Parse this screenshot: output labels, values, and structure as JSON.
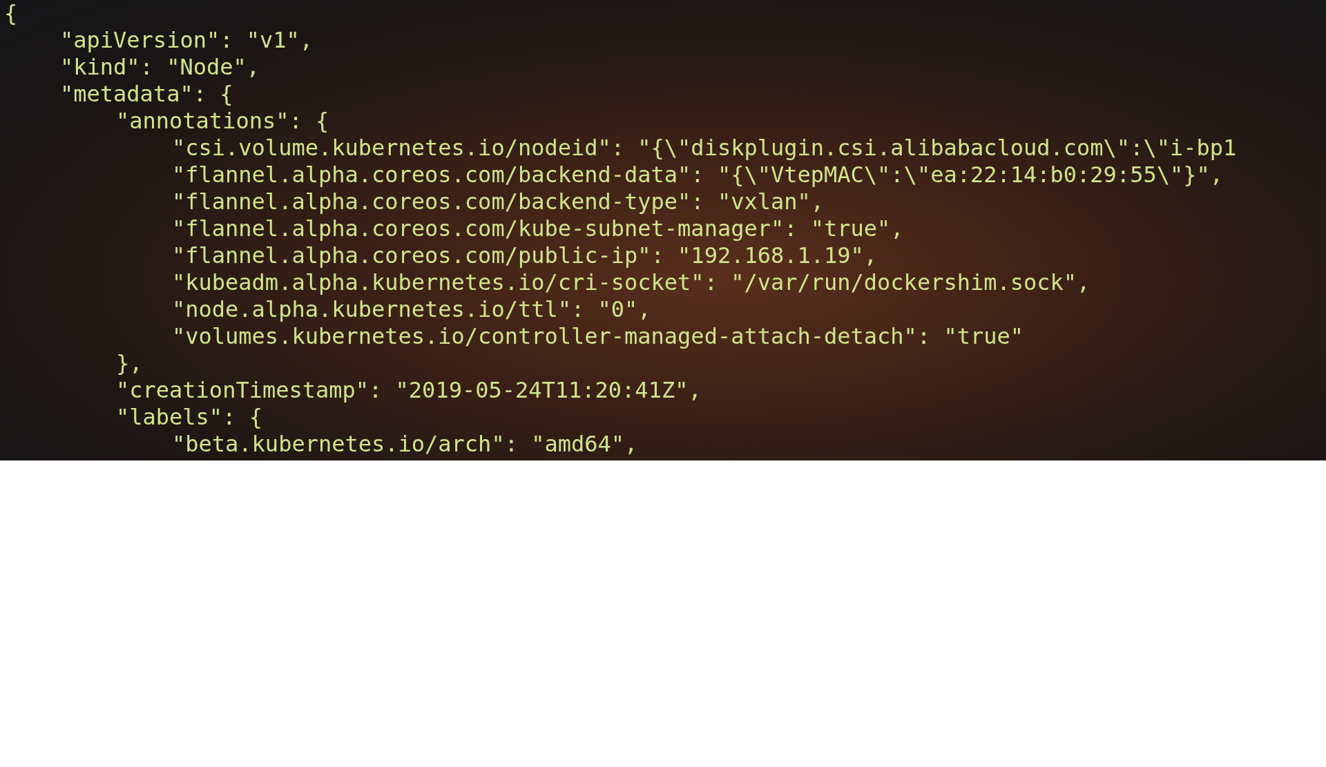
{
  "terminal": {
    "lines": [
      {
        "text": "{",
        "children": [
          {
            "text": "\"apiVersion\": \"v1\","
          },
          {
            "text": "\"kind\": \"Node\","
          },
          {
            "text": "\"metadata\": {",
            "children": [
              {
                "text": "\"annotations\": {",
                "children": [
                  {
                    "text": "\"csi.volume.kubernetes.io/nodeid\": \"{\\\"diskplugin.csi.alibabacloud.com\\\":\\\"i-bp1"
                  },
                  {
                    "text": "\"flannel.alpha.coreos.com/backend-data\": \"{\\\"VtepMAC\\\":\\\"ea:22:14:b0:29:55\\\"}\","
                  },
                  {
                    "text": "\"flannel.alpha.coreos.com/backend-type\": \"vxlan\","
                  },
                  {
                    "text": "\"flannel.alpha.coreos.com/kube-subnet-manager\": \"true\","
                  },
                  {
                    "text": "\"flannel.alpha.coreos.com/public-ip\": \"192.168.1.19\","
                  },
                  {
                    "text": "\"kubeadm.alpha.kubernetes.io/cri-socket\": \"/var/run/dockershim.sock\","
                  },
                  {
                    "text": "\"node.alpha.kubernetes.io/ttl\": \"0\","
                  },
                  {
                    "text": "\"volumes.kubernetes.io/controller-managed-attach-detach\": \"true\""
                  }
                ]
              },
              {
                "text": "},"
              },
              {
                "text": "\"creationTimestamp\": \"2019-05-24T11:20:41Z\","
              },
              {
                "text": "\"labels\": {",
                "children": [
                  {
                    "text": "\"beta.kubernetes.io/arch\": \"amd64\","
                  }
                ]
              }
            ]
          }
        ]
      }
    ]
  }
}
